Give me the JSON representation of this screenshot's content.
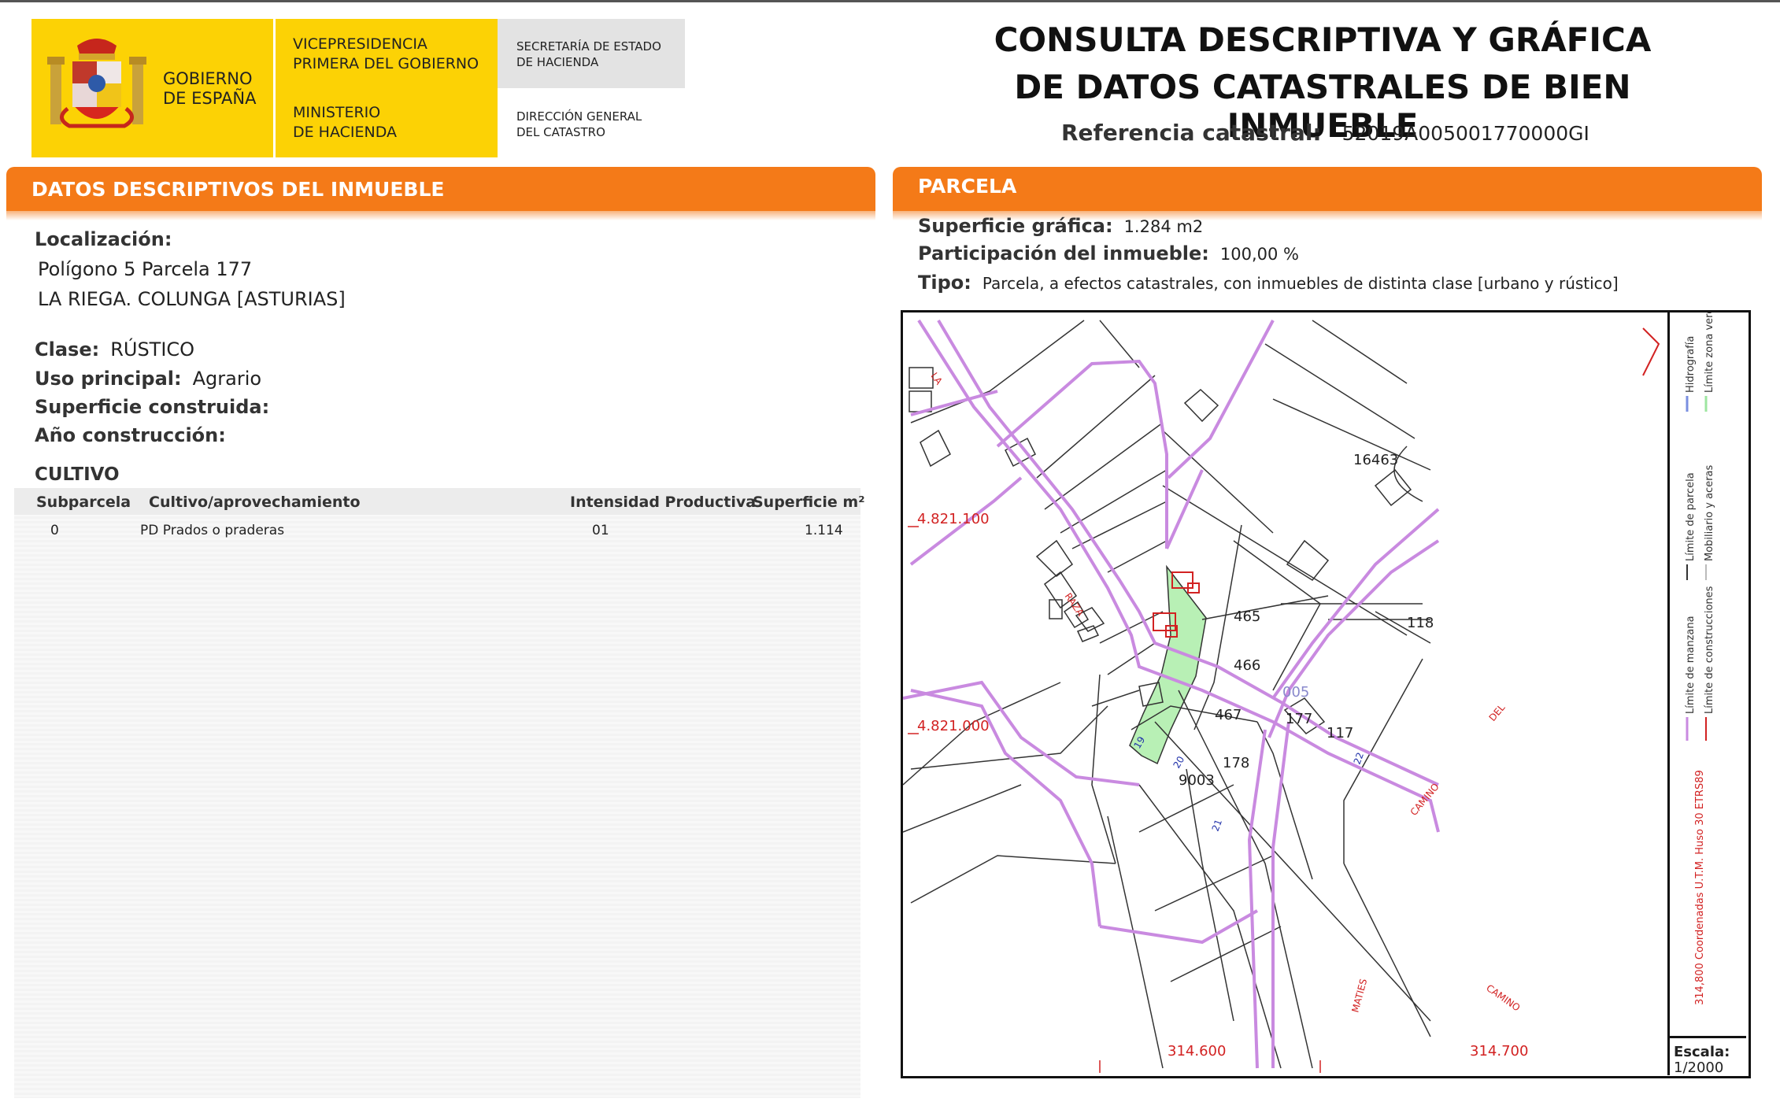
{
  "header": {
    "gov_text": "GOBIERNO\nDE ESPAÑA",
    "vicepresidencia": "VICEPRESIDENCIA\nPRIMERA DEL GOBIERNO",
    "ministerio": "MINISTERIO\nDE HACIENDA",
    "secretaria": "SECRETARÍA DE ESTADO\nDE HACIENDA",
    "direccion": "DIRECCIÓN GENERAL\nDEL CATASTRO",
    "title_line1": "CONSULTA DESCRIPTIVA Y GRÁFICA",
    "title_line2": "DE DATOS CATASTRALES DE BIEN INMUEBLE",
    "ref_label": "Referencia catastral:",
    "ref_value": "52019A005001770000GI"
  },
  "left": {
    "bar_title": "DATOS DESCRIPTIVOS DEL INMUEBLE",
    "localizacion_label": "Localización:",
    "localizacion_line1": "Polígono 5 Parcela 177",
    "localizacion_line2": "LA RIEGA. COLUNGA [ASTURIAS]",
    "clase_label": "Clase:",
    "clase_value": "RÚSTICO",
    "uso_label": "Uso principal:",
    "uso_value": "Agrario",
    "superficie_label": "Superficie construida:",
    "anio_label": "Año construcción:",
    "cultivo_title": "CULTIVO",
    "table": {
      "headers": [
        "Subparcela",
        "Cultivo/aprovechamiento",
        "Intensidad Productiva",
        "Superficie m²"
      ],
      "rows": [
        [
          "0",
          "PD Prados o praderas",
          "01",
          "1.114"
        ]
      ]
    }
  },
  "right": {
    "bar_title": "PARCELA",
    "superficie_label": "Superficie gráfica:",
    "superficie_value": "1.284 m2",
    "participacion_label": "Participación del inmueble:",
    "participacion_value": "100,00 %",
    "tipo_label": "Tipo:",
    "tipo_value": "Parcela, a efectos catastrales, con inmuebles de distinta clase [urbano y rústico]"
  },
  "map": {
    "colors": {
      "boundary": "#c98ae0",
      "highlight": "#b7f0b4",
      "buildings": "#d22222",
      "coords": "#d22222",
      "labels": "#222222"
    },
    "parcel_labels": [
      "16463",
      "465",
      "466",
      "467",
      "118",
      "177",
      "117",
      "178",
      "9003"
    ],
    "small_labels": [
      "005",
      "22",
      "21",
      "20",
      "19",
      "DEL",
      "CAMINO",
      "RAZA",
      "LA",
      "MATIES",
      "CAMINO"
    ],
    "coord_labels": [
      "4.821.100",
      "4.821.000",
      "314.600",
      "314.700"
    ],
    "legend_items": [
      "Límite de manzana",
      "Límite de construcciones",
      "Límite de parcela",
      "Mobiliario y aceras",
      "Hidrografía",
      "Límite zona verde"
    ],
    "legend_coords_note": "314,800 Coordenadas U.T.M. Huso 30 ETRS89",
    "scale_label": "Escala:",
    "scale_value": "1/2000"
  }
}
